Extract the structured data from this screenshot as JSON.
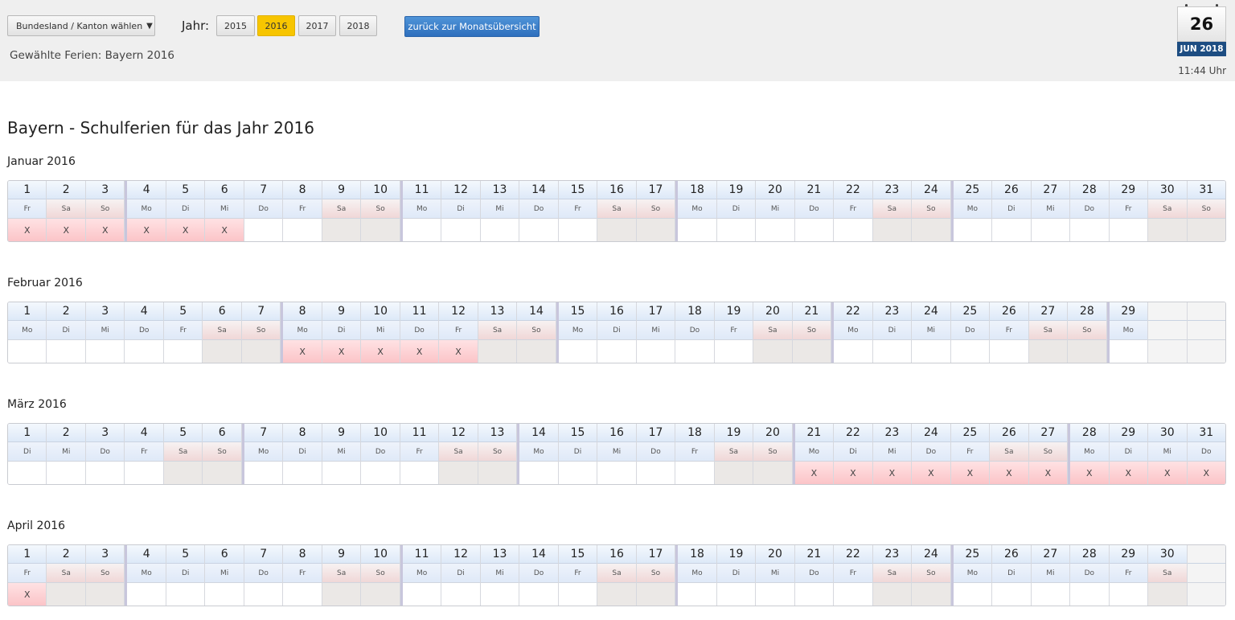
{
  "toolbar": {
    "state_select_label": "Bundesland / Kanton wählen",
    "state_select_caret": "▼",
    "year_label": "Jahr:",
    "years": [
      "2015",
      "2016",
      "2017",
      "2018"
    ],
    "active_year": "2016",
    "back_button_label": "zurück zur Monatsübersicht",
    "selected_holidays": "Gewählte Ferien: Bayern 2016"
  },
  "calendar_widget": {
    "day": "26",
    "month_year": "JUN 2018",
    "time": "11:44 Uhr"
  },
  "page_title": "Bayern - Schulferien für das Jahr 2016",
  "colors": {
    "holiday": "#fbc4c8",
    "weekend": "#ebe8e6",
    "active_year": "#f7c500",
    "header": "#dde9f8"
  },
  "months": [
    {
      "title": "Januar 2016",
      "days": 31,
      "weekdays": [
        "Fr",
        "Sa",
        "So",
        "Mo",
        "Di",
        "Mi",
        "Do",
        "Fr",
        "Sa",
        "So",
        "Mo",
        "Di",
        "Mi",
        "Do",
        "Fr",
        "Sa",
        "So",
        "Mo",
        "Di",
        "Mi",
        "Do",
        "Fr",
        "Sa",
        "So",
        "Mo",
        "Di",
        "Mi",
        "Do",
        "Fr",
        "Sa",
        "So"
      ],
      "holidays": [
        1,
        2,
        3,
        4,
        5,
        6
      ]
    },
    {
      "title": "Februar 2016",
      "days": 29,
      "weekdays": [
        "Mo",
        "Di",
        "Mi",
        "Do",
        "Fr",
        "Sa",
        "So",
        "Mo",
        "Di",
        "Mi",
        "Do",
        "Fr",
        "Sa",
        "So",
        "Mo",
        "Di",
        "Mi",
        "Do",
        "Fr",
        "Sa",
        "So",
        "Mo",
        "Di",
        "Mi",
        "Do",
        "Fr",
        "Sa",
        "So",
        "Mo"
      ],
      "holidays": [
        8,
        9,
        10,
        11,
        12
      ]
    },
    {
      "title": "März 2016",
      "days": 31,
      "weekdays": [
        "Di",
        "Mi",
        "Do",
        "Fr",
        "Sa",
        "So",
        "Mo",
        "Di",
        "Mi",
        "Do",
        "Fr",
        "Sa",
        "So",
        "Mo",
        "Di",
        "Mi",
        "Do",
        "Fr",
        "Sa",
        "So",
        "Mo",
        "Di",
        "Mi",
        "Do",
        "Fr",
        "Sa",
        "So",
        "Mo",
        "Di",
        "Mi",
        "Do"
      ],
      "holidays": [
        21,
        22,
        23,
        24,
        25,
        26,
        27,
        28,
        29,
        30,
        31
      ]
    },
    {
      "title": "April 2016",
      "days": 30,
      "weekdays": [
        "Fr",
        "Sa",
        "So",
        "Mo",
        "Di",
        "Mi",
        "Do",
        "Fr",
        "Sa",
        "So",
        "Mo",
        "Di",
        "Mi",
        "Do",
        "Fr",
        "Sa",
        "So",
        "Mo",
        "Di",
        "Mi",
        "Do",
        "Fr",
        "Sa",
        "So",
        "Mo",
        "Di",
        "Mi",
        "Do",
        "Fr",
        "Sa"
      ],
      "holidays": [
        1
      ]
    }
  ],
  "holiday_mark": "X"
}
